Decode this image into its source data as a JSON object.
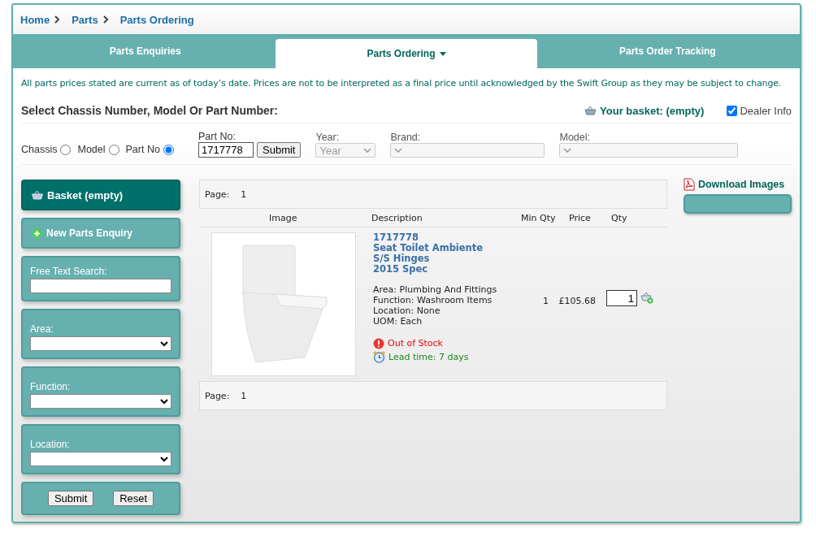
{
  "breadcrumb": [
    {
      "label": "Home",
      "separator": true
    },
    {
      "label": "Parts",
      "separator": true
    },
    {
      "label": "Parts Ordering",
      "separator": false
    }
  ],
  "tabs": [
    {
      "label": "Parts Enquiries",
      "selected": false,
      "dropdown": false
    },
    {
      "label": "Parts Ordering",
      "selected": true,
      "dropdown": true
    },
    {
      "label": "Parts Order Tracking",
      "selected": false,
      "dropdown": false
    }
  ],
  "notice": "All parts prices stated are current as of today’s date. Prices are not to be interpreted as a final price until acknowledged by the Swift Group as they may be subject to change.",
  "heading": "Select Chassis Number, Model Or Part Number:",
  "basket_link": "Your basket: (empty)",
  "dealer_info": {
    "label": "Dealer Info",
    "checked": true
  },
  "search": {
    "radios": [
      {
        "label": "Chassis",
        "selected": false
      },
      {
        "label": "Model",
        "selected": false
      },
      {
        "label": "Part No",
        "selected": true
      }
    ],
    "part_no": {
      "label": "Part No:",
      "value": "1717778"
    },
    "submit": "Submit",
    "selects": [
      {
        "label": "Year:",
        "value": "Year",
        "disabled": true
      },
      {
        "label": "Brand:",
        "disabled": true
      },
      {
        "label": "Model:",
        "disabled": true
      }
    ]
  },
  "sidebar": {
    "basket_button": "Basket (empty)",
    "new_enquiry": "New Parts Enquiry",
    "free_text": {
      "label": "Free Text Search:"
    },
    "filters": [
      {
        "label": "Area:"
      },
      {
        "label": "Function:"
      },
      {
        "label": "Location:"
      }
    ],
    "buttons": [
      "Submit",
      "Reset"
    ]
  },
  "results": {
    "pager_top": {
      "label": "Page:",
      "page": "1"
    },
    "columns": [
      "Image",
      "Description",
      "Min Qty",
      "Price",
      "Qty"
    ],
    "rows": [
      {
        "part_number": "1717778",
        "title_lines": [
          "Seat Toilet Ambiente",
          "S/S Hinges",
          "2015 Spec"
        ],
        "details": [
          "Area: Plumbing And Fittings",
          "Function: Washroom Items",
          "Location: None",
          "UOM: Each"
        ],
        "stock": "Out of Stock",
        "lead_time": "Lead time: 7 days",
        "min_qty": "1",
        "price": "£105.68",
        "qty": "1"
      }
    ],
    "pager_bottom": {
      "label": "Page:",
      "page": "1"
    }
  },
  "download_images": "Download Images"
}
